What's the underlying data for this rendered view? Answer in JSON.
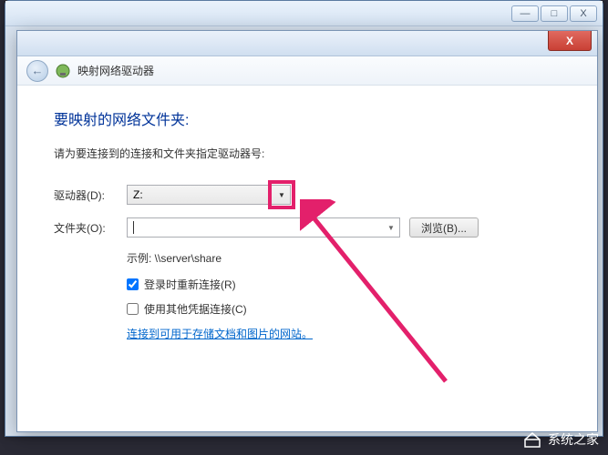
{
  "outer_window": {
    "minimize": "—",
    "maximize": "□",
    "close": "X"
  },
  "inner_window": {
    "close": "X",
    "nav_title": "映射网络驱动器"
  },
  "content": {
    "heading": "要映射的网络文件夹:",
    "subtext": "请为要连接到的连接和文件夹指定驱动器号:",
    "drive_label": "驱动器(D):",
    "drive_value": "Z:",
    "folder_label": "文件夹(O):",
    "folder_value": "",
    "browse_btn": "浏览(B)...",
    "example": "示例: \\\\server\\share",
    "reconnect_label": "登录时重新连接(R)",
    "credentials_label": "使用其他凭据连接(C)",
    "link": "连接到可用于存储文档和图片的网站。"
  },
  "watermark": {
    "text": "系统之家"
  }
}
